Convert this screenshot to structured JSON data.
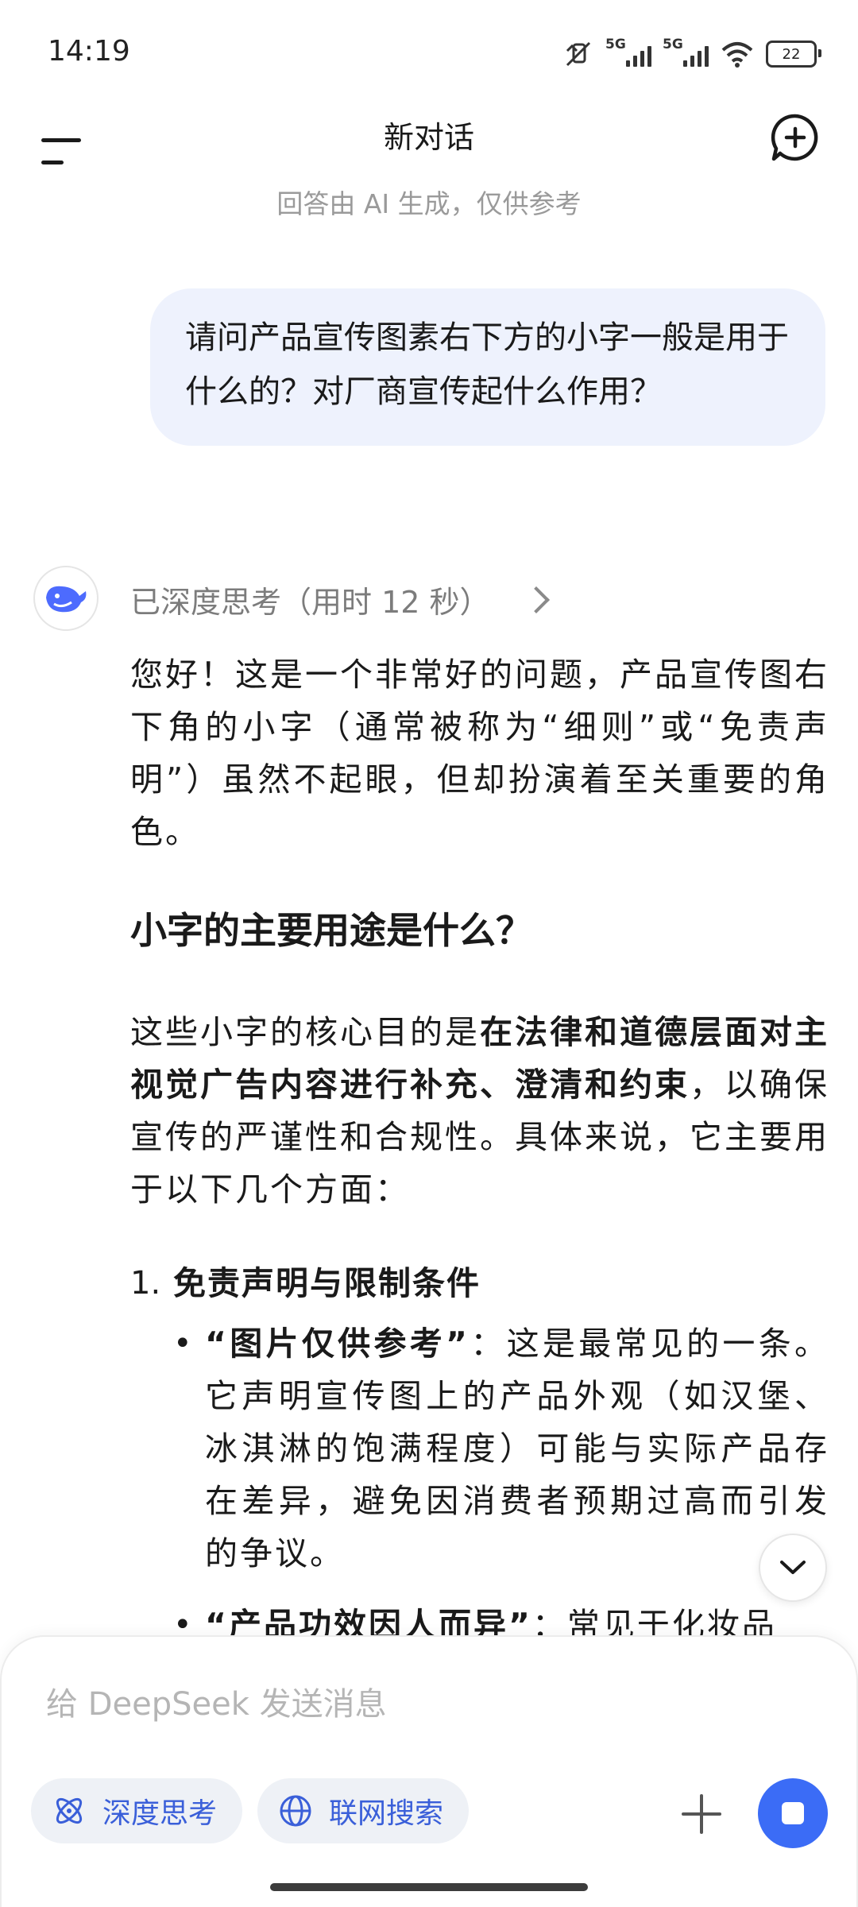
{
  "status_bar": {
    "time": "14:19",
    "network_1": "5G",
    "network_2": "5G",
    "battery": "22"
  },
  "header": {
    "title": "新对话",
    "disclaimer": "回答由 AI 生成，仅供参考"
  },
  "user_message": "请问产品宣传图素右下方的小字一般是用于什么的？对厂商宣传起什么作用？",
  "assistant": {
    "thinking_label": "已深度思考（用时 12 秒）",
    "intro": "您好！这是一个非常好的问题，产品宣传图右下角的小字（通常被称为“细则”或“免责声明”）虽然不起眼，但却扮演着至关重要的角色。",
    "heading": "小字的主要用途是什么？",
    "p2_before": "这些小字的核心目的是",
    "p2_bold": "在法律和道德层面对主视觉广告内容进行补充、澄清和约束",
    "p2_after": "，以确保宣传的严谨性和合规性。具体来说，它主要用于以下几个方面：",
    "list_item_1": {
      "number": "1.",
      "title": "免责声明与限制条件",
      "bullet_1_bold": "“图片仅供参考”",
      "bullet_1_text": "：这是最常见的一条。它声明宣传图上的产品外观（如汉堡、冰淇淋的饱满程度）可能与实际产品存在差异，避免因消费者预期过高而引发的争议。",
      "bullet_2_bold": "“产品功效因人而异”",
      "bullet_2_text": "：常见于化妆品"
    }
  },
  "composer": {
    "placeholder": "给 DeepSeek 发送消息",
    "deep_think_label": "深度思考",
    "web_search_label": "联网搜索"
  },
  "colors": {
    "accent": "#3b6cf6",
    "bubble": "#eef2fd",
    "pill_bg": "#eef1f6"
  }
}
